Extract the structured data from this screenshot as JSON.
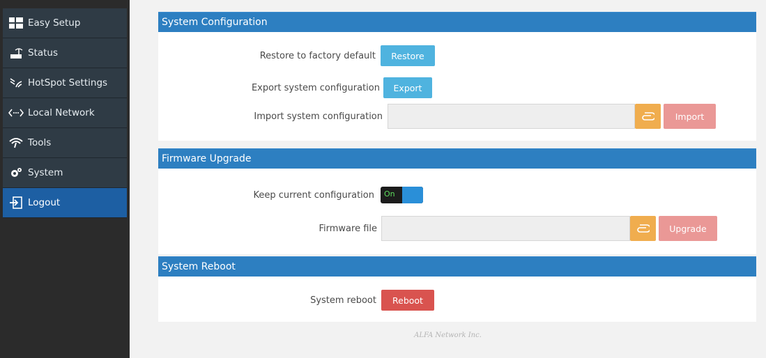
{
  "sidebar": {
    "items": [
      {
        "label": "Easy Setup",
        "icon": "grid-icon"
      },
      {
        "label": "Status",
        "icon": "router-icon"
      },
      {
        "label": "HotSpot Settings",
        "icon": "hotspot-icon"
      },
      {
        "label": "Local Network",
        "icon": "network-arrows-icon"
      },
      {
        "label": "Tools",
        "icon": "wifi-icon"
      },
      {
        "label": "System",
        "icon": "gear-icon"
      },
      {
        "label": "Logout",
        "icon": "logout-icon"
      }
    ],
    "active_index": 6
  },
  "system_configuration": {
    "title": "System Configuration",
    "restore_label": "Restore to factory default",
    "restore_button": "Restore",
    "export_label": "Export system configuration",
    "export_button": "Export",
    "import_label": "Import system configuration",
    "import_value": "",
    "import_button": "Import"
  },
  "firmware_upgrade": {
    "title": "Firmware Upgrade",
    "keep_config_label": "Keep current configuration",
    "keep_config_state": "On",
    "firmware_file_label": "Firmware file",
    "firmware_file_value": "",
    "upgrade_button": "Upgrade"
  },
  "system_reboot": {
    "title": "System Reboot",
    "reboot_label": "System reboot",
    "reboot_button": "Reboot"
  },
  "footer": {
    "text": "ALFA Network Inc."
  },
  "colors": {
    "header_blue": "#2d7fc1",
    "active_nav": "#1d5fa3",
    "info_button": "#4fb3df",
    "danger_button": "#d9534f",
    "attach_button": "#f0ad4e"
  }
}
